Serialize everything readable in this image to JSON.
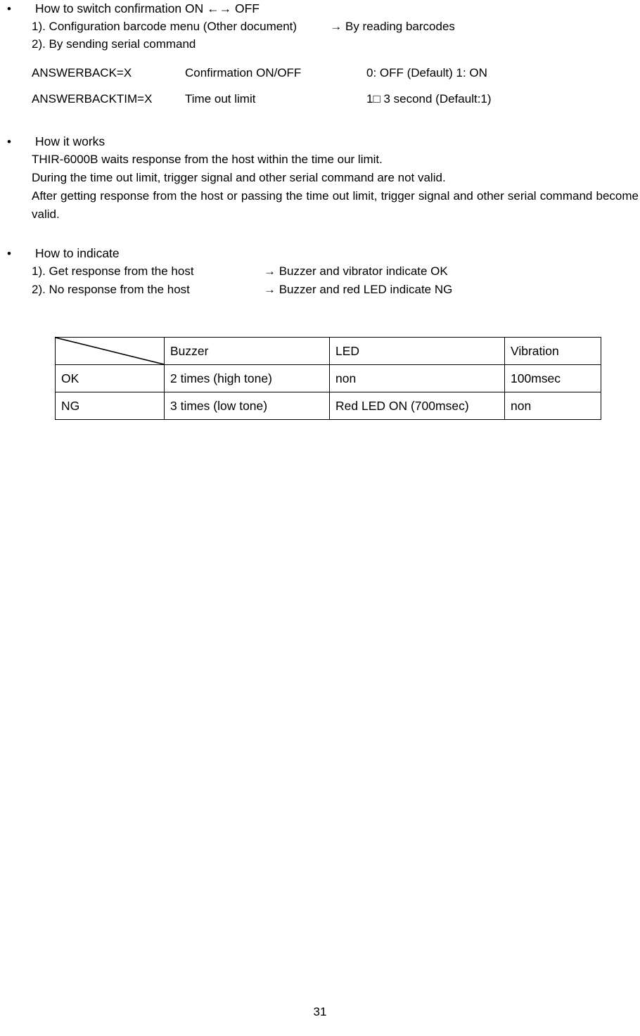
{
  "document": {
    "page_number": "31"
  },
  "sections": [
    {
      "bullet": "•",
      "title": "How to switch confirmation ON ←→ OFF",
      "lines": [
        "1). Configuration barcode menu (Other document)          → By reading barcodes",
        "2). By sending serial command"
      ]
    }
  ],
  "switch_section": {
    "bullet": "•",
    "title": "How to switch confirmation ON ←→ OFF",
    "item1": "1). Configuration barcode menu (Other document)          → By reading barcodes",
    "item2": "2). By sending serial command",
    "commands": [
      {
        "name": "ANSWERBACK=X",
        "description": "Confirmation ON/OFF",
        "values": "0: OFF (Default) 1: ON"
      },
      {
        "name": "ANSWERBACKTIM=X",
        "description": "Time out limit",
        "values": "1□ 3 second (Default:1)"
      }
    ]
  },
  "works_section": {
    "bullet": "•",
    "title": "How it works",
    "line1": "THIR-6000B waits response from the host within the time our limit.",
    "line2": "During the time out limit, trigger signal and other serial command are not valid.",
    "paragraph": "After getting response from the host or passing the time out limit, trigger signal and other serial command become valid."
  },
  "indicate_section": {
    "bullet": "•",
    "title": "How to indicate",
    "item1_left": "1). Get response from the host",
    "item1_right": "→ Buzzer and vibrator indicate OK",
    "item2_left": "2). No response from the host",
    "item2_right": "→ Buzzer and red LED indicate NG"
  },
  "indicate_table": {
    "corner_label": "",
    "headers": [
      "Buzzer",
      "LED",
      "Vibration"
    ],
    "rows": [
      {
        "label": "OK",
        "buzzer": "2 times (high tone)",
        "led": "non",
        "vibration": "100msec"
      },
      {
        "label": "NG",
        "buzzer": "3 times (low tone)",
        "led": "Red LED ON (700msec)",
        "vibration": "non"
      }
    ]
  }
}
